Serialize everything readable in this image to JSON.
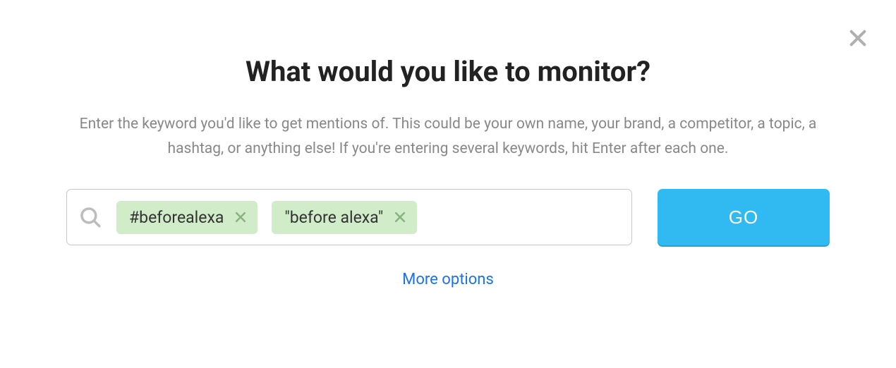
{
  "modal": {
    "heading": "What would you like to monitor?",
    "description": "Enter the keyword you'd like to get mentions of. This could be your own name, your brand, a competitor, a topic, a hashtag, or anything else! If you're entering several keywords, hit Enter after each one.",
    "go_label": "GO",
    "more_options_label": "More options"
  },
  "search": {
    "placeholder": "",
    "value": "",
    "tags": [
      {
        "label": "#beforealexa"
      },
      {
        "label": "\"before alexa\""
      }
    ]
  },
  "colors": {
    "accent": "#31baf2",
    "tag_bg": "#d1ecc9",
    "link": "#1a73e8"
  }
}
